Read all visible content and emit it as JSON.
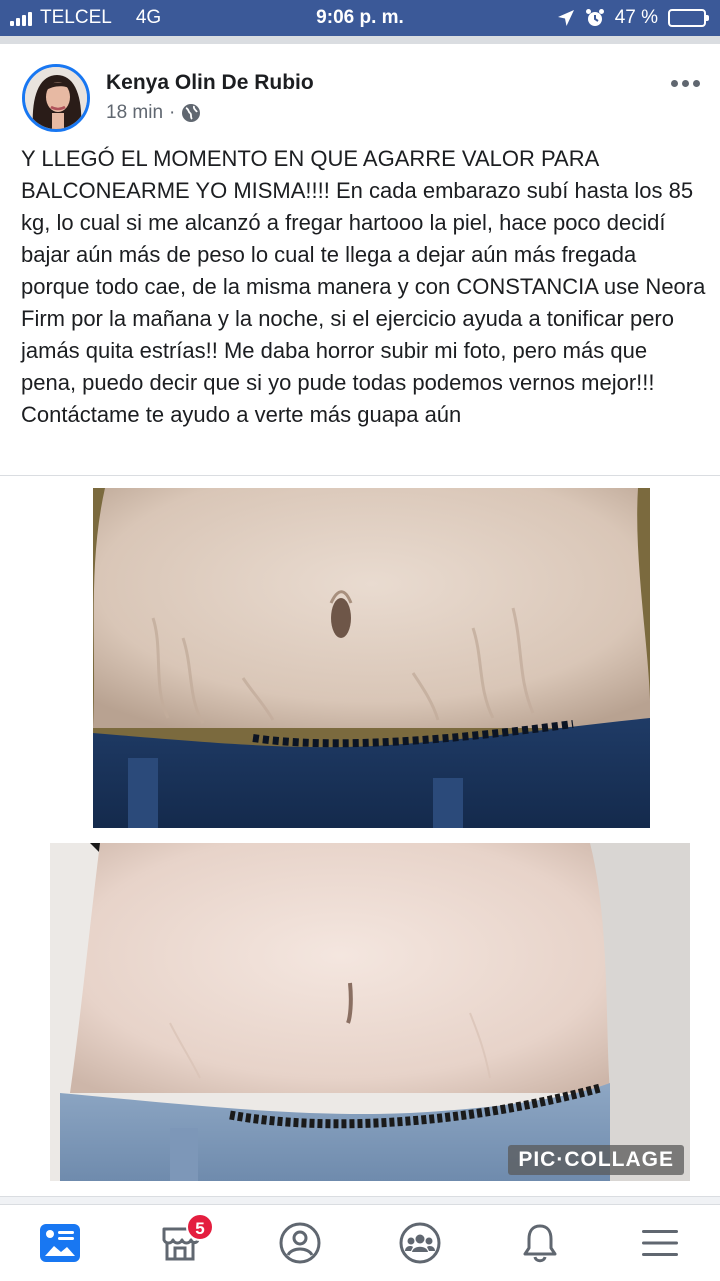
{
  "status_bar": {
    "carrier": "TELCEL",
    "network": "4G",
    "time": "9:06 p. m.",
    "battery": "47 %",
    "battery_level": 0.47,
    "icons": [
      "signal-icon",
      "location-arrow-icon",
      "alarm-icon",
      "battery-icon"
    ]
  },
  "post": {
    "author": "Kenya Olin De Rubio",
    "time_ago": "18 min",
    "separator": "·",
    "audience_icon": "globe-icon",
    "text": "Y LLEGÓ EL MOMENTO EN QUE AGARRE VALOR PARA BALCONEARME YO MISMA!!!! En cada embarazo subí hasta los 85 kg, lo cual si me alcanzó a fregar hartooo la piel, hace poco decidí bajar aún más de peso lo cual te llega a dejar aún más fregada porque todo cae, de la misma manera y con CONSTANCIA use Neora Firm por la mañana y la noche, si el ejercicio ayuda a tonificar pero jamás quita estrías!! Me daba horror subir mi foto, pero más que pena, puedo decir que si yo pude todas podemos vernos mejor!!! Contáctame te ayudo a verte más guapa aún",
    "watermark": "PIC·COLLAGE"
  },
  "tab_bar": {
    "tabs": [
      {
        "icon": "news-feed-icon",
        "active": true
      },
      {
        "icon": "marketplace-icon",
        "badge": "5"
      },
      {
        "icon": "profile-icon"
      },
      {
        "icon": "groups-icon"
      },
      {
        "icon": "notifications-bell-icon"
      },
      {
        "icon": "menu-icon"
      }
    ]
  },
  "colors": {
    "status_bar": "#3b5998",
    "accent": "#1877f2",
    "badge": "#e41e3f",
    "text": "#1c1e21",
    "secondary_text": "#606770"
  }
}
